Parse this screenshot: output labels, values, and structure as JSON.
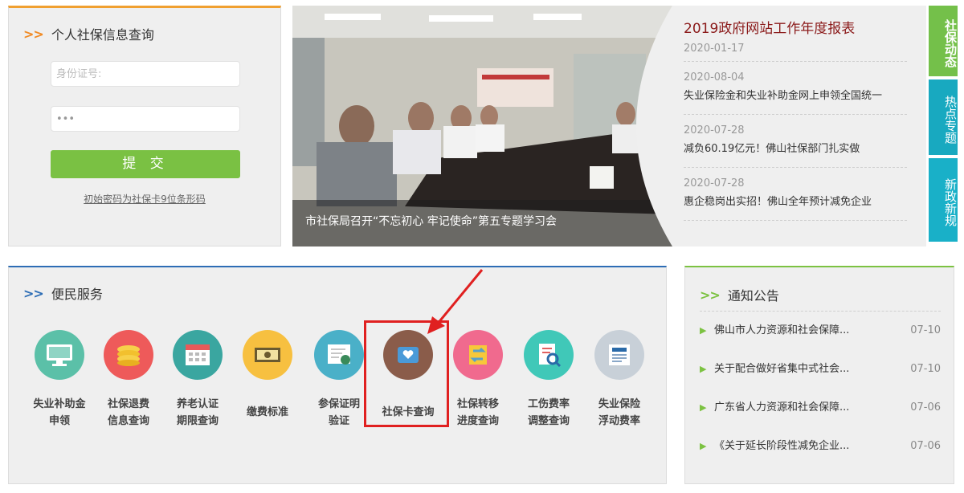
{
  "login": {
    "title": "个人社保信息查询",
    "id_placeholder": "身份证号:",
    "password_value": "•••",
    "submit_label": "提 交",
    "hint": "初始密码为社保卡9位条形码"
  },
  "banner": {
    "caption": "市社保局召开“不忘初心 牢记使命”第五专题学习会"
  },
  "news": {
    "headline": "2019政府网站工作年度报表",
    "headline_date": "2020-01-17",
    "items": [
      {
        "date": "2020-08-04",
        "title": "失业保险金和失业补助金网上申领全国统一"
      },
      {
        "date": "2020-07-28",
        "title": "减负60.19亿元！佛山社保部门扎实做"
      },
      {
        "date": "2020-07-28",
        "title": "惠企稳岗出实招！佛山全年预计减免企业"
      }
    ]
  },
  "tabs": [
    "社保动态",
    "热点专题",
    "新政新规"
  ],
  "services": {
    "title": "便民服务",
    "items": [
      {
        "label1": "失业补助金",
        "label2": "申领",
        "color": "#5bc0a8",
        "icon": "monitor-icon"
      },
      {
        "label1": "社保退费",
        "label2": "信息查询",
        "color": "#ee5a5a",
        "icon": "coins-icon"
      },
      {
        "label1": "养老认证",
        "label2": "期限查询",
        "color": "#3aa6a0",
        "icon": "calendar-icon"
      },
      {
        "label1": "缴费标准",
        "label2": "",
        "color": "#f7c040",
        "icon": "money-icon"
      },
      {
        "label1": "参保证明",
        "label2": "验证",
        "color": "#4ab0c8",
        "icon": "certificate-icon"
      },
      {
        "label1": "社保卡查询",
        "label2": "",
        "color": "#8a5c4a",
        "icon": "card-icon"
      },
      {
        "label1": "社保转移",
        "label2": "进度查询",
        "color": "#f06a8e",
        "icon": "transfer-icon"
      },
      {
        "label1": "工伤费率",
        "label2": "调整查询",
        "color": "#40c8b8",
        "icon": "document-search-icon"
      },
      {
        "label1": "失业保险",
        "label2": "浮动费率",
        "color": "#c8d0d8",
        "icon": "newspaper-icon"
      }
    ]
  },
  "notices": {
    "title": "通知公告",
    "items": [
      {
        "title": "佛山市人力资源和社会保障...",
        "date": "07-10"
      },
      {
        "title": "关于配合做好省集中式社会...",
        "date": "07-10"
      },
      {
        "title": "广东省人力资源和社会保障...",
        "date": "07-06"
      },
      {
        "title": "《关于延长阶段性减免企业...",
        "date": "07-06"
      }
    ]
  }
}
